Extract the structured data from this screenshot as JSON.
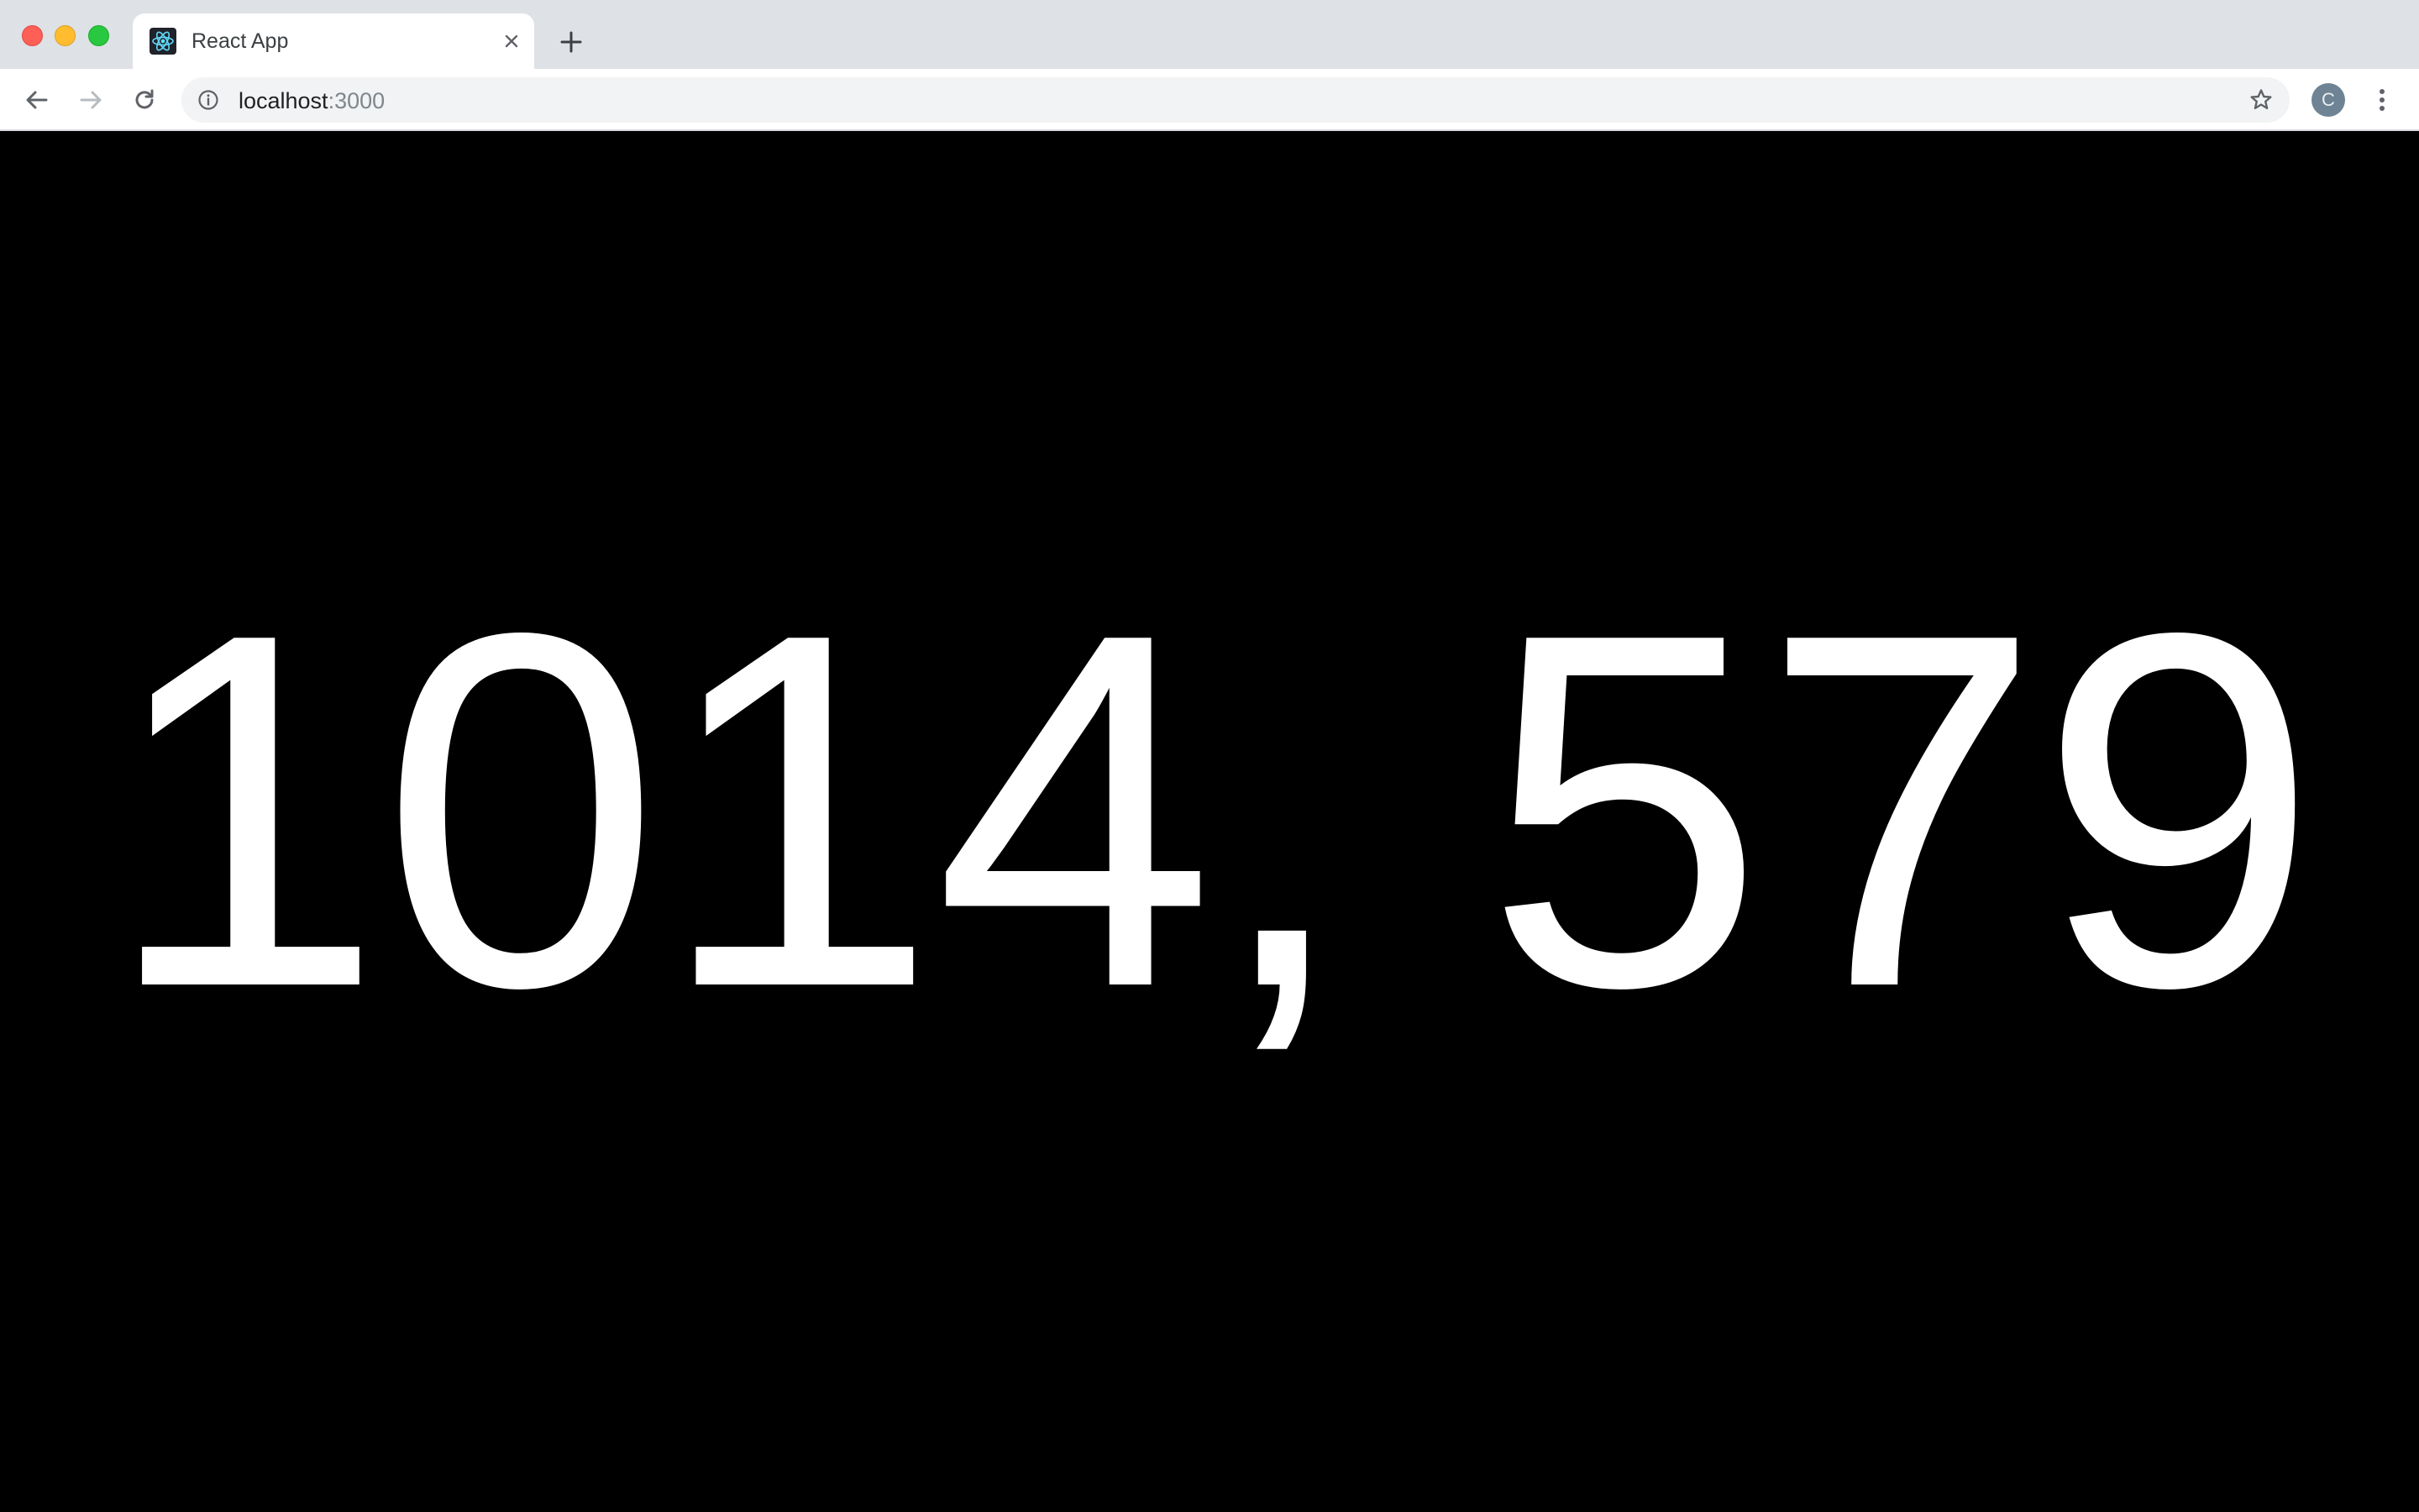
{
  "browser": {
    "tab": {
      "title": "React App",
      "favicon": "react-logo-icon"
    },
    "new_tab_icon": "plus-icon",
    "toolbar": {
      "back_icon": "arrow-left-icon",
      "forward_icon": "arrow-right-icon",
      "reload_icon": "reload-icon",
      "address": {
        "host": "localhost",
        "port": ":3000",
        "info_icon": "info-icon"
      },
      "bookmark_icon": "star-icon",
      "profile_initial": "C",
      "menu_icon": "kebab-menu-icon"
    },
    "colors": {
      "tabstrip": "#dee1e6",
      "page_background": "#000000",
      "page_text": "#ffffff"
    }
  },
  "page": {
    "coordinates_text": "1014, 579"
  }
}
